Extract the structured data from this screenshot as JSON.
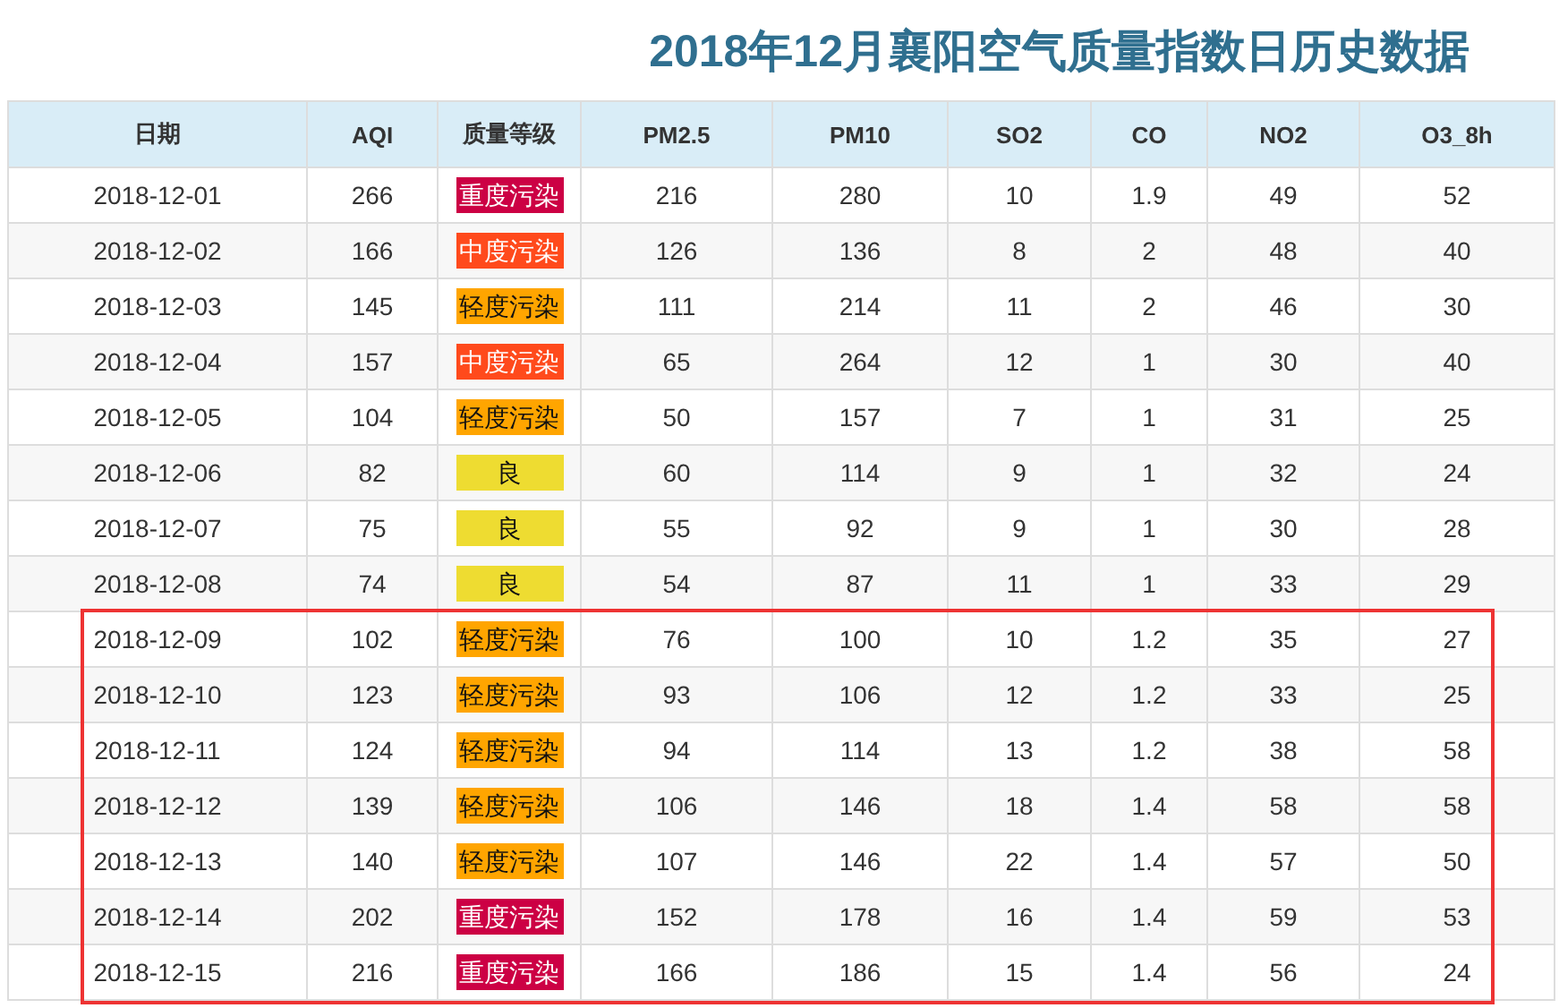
{
  "title": "2018年12月襄阳空气质量指数日历史数据",
  "table": {
    "columns": [
      "日期",
      "AQI",
      "质量等级",
      "PM2.5",
      "PM10",
      "SO2",
      "CO",
      "NO2",
      "O3_8h"
    ],
    "row_groups": [
      {
        "highlighted": false,
        "rows": [
          {
            "date": "2018-12-01",
            "aqi": "266",
            "level": {
              "label": "重度污染",
              "kind": "severe",
              "color": "#cc0044"
            },
            "values": [
              "216",
              "280",
              "10",
              "1.9",
              "49",
              "52"
            ]
          },
          {
            "date": "2018-12-02",
            "aqi": "166",
            "level": {
              "label": "中度污染",
              "kind": "moderate",
              "color": "#ff4a1c"
            },
            "values": [
              "126",
              "136",
              "8",
              "2",
              "48",
              "40"
            ]
          },
          {
            "date": "2018-12-03",
            "aqi": "145",
            "level": {
              "label": "轻度污染",
              "kind": "light",
              "color": "#ffa500"
            },
            "values": [
              "111",
              "214",
              "11",
              "2",
              "46",
              "30"
            ]
          },
          {
            "date": "2018-12-04",
            "aqi": "157",
            "level": {
              "label": "中度污染",
              "kind": "moderate",
              "color": "#ff4a1c"
            },
            "values": [
              "65",
              "264",
              "12",
              "1",
              "30",
              "40"
            ]
          },
          {
            "date": "2018-12-05",
            "aqi": "104",
            "level": {
              "label": "轻度污染",
              "kind": "light",
              "color": "#ffa500"
            },
            "values": [
              "50",
              "157",
              "7",
              "1",
              "31",
              "25"
            ]
          },
          {
            "date": "2018-12-06",
            "aqi": "82",
            "level": {
              "label": "良",
              "kind": "good",
              "color": "#eedc31"
            },
            "values": [
              "60",
              "114",
              "9",
              "1",
              "32",
              "24"
            ]
          },
          {
            "date": "2018-12-07",
            "aqi": "75",
            "level": {
              "label": "良",
              "kind": "good",
              "color": "#eedc31"
            },
            "values": [
              "55",
              "92",
              "9",
              "1",
              "30",
              "28"
            ]
          },
          {
            "date": "2018-12-08",
            "aqi": "74",
            "level": {
              "label": "良",
              "kind": "good",
              "color": "#eedc31"
            },
            "values": [
              "54",
              "87",
              "11",
              "1",
              "33",
              "29"
            ]
          }
        ]
      },
      {
        "highlighted": true,
        "rows": [
          {
            "date": "2018-12-09",
            "aqi": "102",
            "level": {
              "label": "轻度污染",
              "kind": "light",
              "color": "#ffa500"
            },
            "values": [
              "76",
              "100",
              "10",
              "1.2",
              "35",
              "27"
            ]
          },
          {
            "date": "2018-12-10",
            "aqi": "123",
            "level": {
              "label": "轻度污染",
              "kind": "light",
              "color": "#ffa500"
            },
            "values": [
              "93",
              "106",
              "12",
              "1.2",
              "33",
              "25"
            ]
          },
          {
            "date": "2018-12-11",
            "aqi": "124",
            "level": {
              "label": "轻度污染",
              "kind": "light",
              "color": "#ffa500"
            },
            "values": [
              "94",
              "114",
              "13",
              "1.2",
              "38",
              "58"
            ]
          },
          {
            "date": "2018-12-12",
            "aqi": "139",
            "level": {
              "label": "轻度污染",
              "kind": "light",
              "color": "#ffa500"
            },
            "values": [
              "106",
              "146",
              "18",
              "1.4",
              "58",
              "58"
            ]
          },
          {
            "date": "2018-12-13",
            "aqi": "140",
            "level": {
              "label": "轻度污染",
              "kind": "light",
              "color": "#ffa500"
            },
            "values": [
              "107",
              "146",
              "22",
              "1.4",
              "57",
              "50"
            ]
          },
          {
            "date": "2018-12-14",
            "aqi": "202",
            "level": {
              "label": "重度污染",
              "kind": "severe",
              "color": "#cc0044"
            },
            "values": [
              "152",
              "178",
              "16",
              "1.4",
              "59",
              "53"
            ]
          },
          {
            "date": "2018-12-15",
            "aqi": "216",
            "level": {
              "label": "重度污染",
              "kind": "severe",
              "color": "#cc0044"
            },
            "values": [
              "166",
              "186",
              "15",
              "1.4",
              "56",
              "24"
            ]
          }
        ]
      }
    ]
  }
}
